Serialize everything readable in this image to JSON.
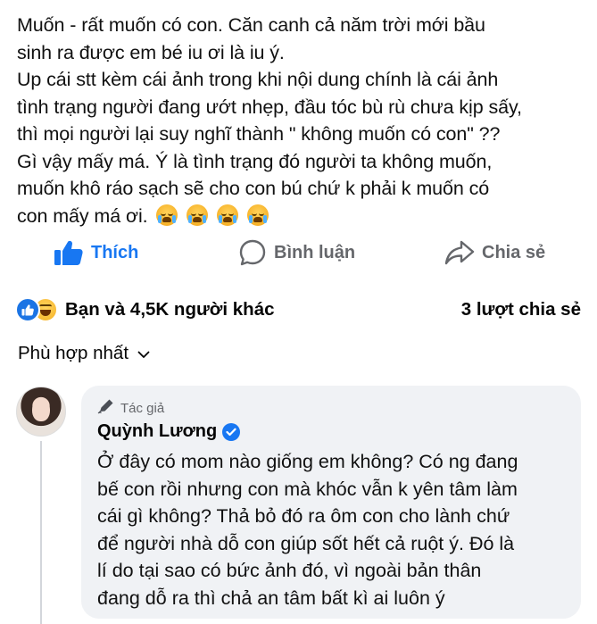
{
  "post": {
    "lines": [
      "Muốn - rất muốn có con. Căn canh cả năm trời mới bầu",
      "sinh ra được em bé iu ơi là iu ý.",
      "Up cái stt kèm cái ảnh trong khi nội dung chính là cái ảnh",
      "tình trạng người đang ướt nhẹp, đầu tóc bù rù chưa kịp sấy,",
      "thì mọi người lại suy nghĩ thành \" không muốn có con\" ??",
      "Gì vậy mấy má. Ý là tình trạng đó người ta không muốn,",
      "muốn khô ráo sạch sẽ cho con bú  chứ k phải k muốn có",
      "con mấy má ơi."
    ],
    "emoji_count_icon": "loudly-crying-face-icon"
  },
  "actions": {
    "like": "Thích",
    "comment": "Bình luận",
    "share": "Chia sẻ"
  },
  "reactions": {
    "summary": "Bạn và 4,5K người khác",
    "shares": "3 lượt chia sẻ"
  },
  "sort": {
    "label": "Phù hợp nhất"
  },
  "comment": {
    "author_tag": "Tác giả",
    "author_name": "Quỳnh Lương",
    "lines": [
      "Ở đây có mom nào giống em không? Có ng đang",
      "bế con rồi nhưng con mà khóc vẫn k yên tâm làm",
      "cái gì không? Thả bỏ đó ra ôm con cho lành chứ",
      "để người nhà dỗ con giúp sốt hết cả ruột ý. Đó là",
      "lí do tại sao có bức ảnh đó, vì ngoài bản thân",
      "đang dỗ ra thì chả an tâm bất kì ai luôn ý"
    ]
  },
  "colors": {
    "accent": "#1877f2",
    "muted": "#65676b",
    "bubble": "#f0f2f5"
  }
}
